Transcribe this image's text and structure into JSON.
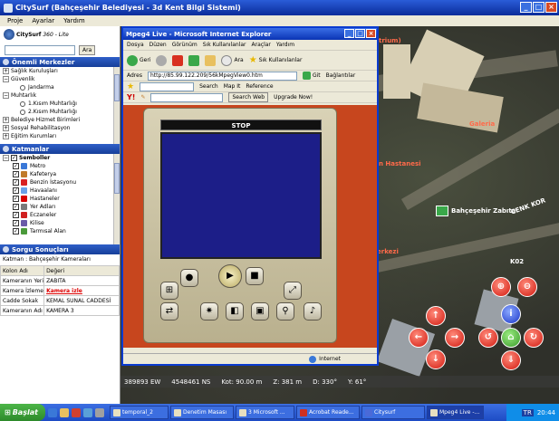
{
  "app": {
    "title": "CitySurf  (Bahçeşehir Belediyesi - 3d Kent Bilgi Sistemi)",
    "menu": [
      "Proje",
      "Ayarlar",
      "Yardım"
    ]
  },
  "left": {
    "logo_text": "CitySurf",
    "logo_sub": "360 - Lite",
    "search_button": "Ara",
    "sections": {
      "centers": "Önemli Merkezler",
      "layers": "Katmanlar",
      "query": "Sorgu Sonuçları"
    },
    "centers_tree": [
      {
        "type": "plus",
        "label": "Sağlık Kuruluşları"
      },
      {
        "type": "minus",
        "label": "Güvenlik"
      },
      {
        "type": "radio",
        "label": "Jandarma"
      },
      {
        "type": "minus",
        "label": "Muhtarlık"
      },
      {
        "type": "radio",
        "label": "1.Kısım Muhtarlığı"
      },
      {
        "type": "radio",
        "label": "2.Kısım Muhtarlığı"
      },
      {
        "type": "plus",
        "label": "Belediye Hizmet Birimleri"
      },
      {
        "type": "plus",
        "label": "Sosyal Rehabilitasyon"
      },
      {
        "type": "plus",
        "label": "Eğitim Kurumları"
      }
    ],
    "layers_root": "Semboller",
    "layers": [
      {
        "label": "Metro",
        "color": "#3a78d8"
      },
      {
        "label": "Kafeterya",
        "color": "#c07a2a"
      },
      {
        "label": "Benzin İstasyonu",
        "color": "#d82020"
      },
      {
        "label": "Havaalanı",
        "color": "#6aa0e8"
      },
      {
        "label": "Hastaneler",
        "color": "#d80000"
      },
      {
        "label": "Yer Adları",
        "color": "#7a7a7a"
      },
      {
        "label": "Eczaneler",
        "color": "#d02020"
      },
      {
        "label": "Kilise",
        "color": "#6a5aa8"
      },
      {
        "label": "Tarmısal Alan",
        "color": "#4a9a3a"
      }
    ],
    "query_layer": "Katman :  Bahçeşehir Kameraları",
    "query_header": [
      "Kolon Adı",
      "Değeri"
    ],
    "query_rows": [
      {
        "k": "Kameranın Yeri",
        "v": "ZABITA"
      },
      {
        "k": "Kamera İzleme",
        "v": "Kamera izle"
      },
      {
        "k": "Cadde Sokak",
        "v": "KEMAL SUNAL CADDESİ"
      },
      {
        "k": "Kameranın Adı",
        "v": "KAMERA 3"
      }
    ]
  },
  "map": {
    "labels": {
      "trium": "trium)",
      "galeria": "Galeria",
      "hastane": "n Hastanesi",
      "cenk": "CENK KOR",
      "zabita": "Bahçeşehir Zabıta",
      "erkezi": "erkezi",
      "k02": "K02"
    },
    "status": [
      "389893 EW",
      "4548461 NS",
      "Kot: 90.00 m",
      "Z: 381 m",
      "D: 330°",
      "Y: 61°"
    ]
  },
  "ie": {
    "title": "Mpeg4 Live - Microsoft Internet Explorer",
    "menu": [
      "Dosya",
      "Düzen",
      "Görünüm",
      "Sık Kullanılanlar",
      "Araçlar",
      "Yardım"
    ],
    "back": "Geri",
    "search": "Ara",
    "favorites": "Sık Kullanılanlar",
    "address_label": "Adres",
    "address": "http://85.99.122.209/56kMpegView0.htm",
    "go": "Git",
    "links": "Bağlantılar",
    "toolbar2": [
      "Search",
      "Map It",
      "Reference"
    ],
    "yahoo_search": "Search Web",
    "upgrade": "Upgrade Now!",
    "player_status": "STOP",
    "zone": "Internet"
  },
  "taskbar": {
    "start": "Başlat",
    "tasks": [
      "temporal_2",
      "Denetim Masası",
      "3 Microsoft ...",
      "Acrobat Reade...",
      "Citysurf",
      "Mpeg4 Live -..."
    ],
    "lang": "TR",
    "clock": "20:44"
  }
}
